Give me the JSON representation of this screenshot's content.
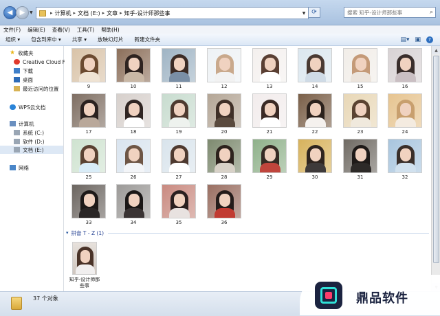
{
  "address_bar": {
    "crumbs": [
      "计算机",
      "文档 (E:)",
      "文章",
      "知乎-设计师那些事"
    ],
    "search_placeholder": "搜索 知乎-设计师那些事"
  },
  "menu": [
    "文件(F)",
    "编辑(E)",
    "查看(V)",
    "工具(T)",
    "帮助(H)"
  ],
  "toolbar": {
    "organize": "组织 ▾",
    "include_library": "包含到库中 ▾",
    "share": "共享 ▾",
    "slideshow": "放映幻灯片",
    "new_folder": "新建文件夹"
  },
  "sidebar": {
    "favorites": "收藏夹",
    "creative_cloud": "Creative Cloud Files",
    "downloads": "下载",
    "desktop": "桌面",
    "recent": "最近访问的位置",
    "wps_cloud": "WPS云文档",
    "computer": "计算机",
    "drive_c": "系统 (C:)",
    "drive_d": "软件 (D:)",
    "drive_e": "文档 (E:)",
    "network": "网络"
  },
  "thumbnails": [
    "9",
    "10",
    "11",
    "12",
    "13",
    "14",
    "15",
    "16",
    "17",
    "18",
    "19",
    "20",
    "21",
    "22",
    "23",
    "24",
    "25",
    "26",
    "27",
    "28",
    "29",
    "30",
    "31",
    "32",
    "33",
    "34",
    "35",
    "36"
  ],
  "group_header": "拼音 T - Z (1)",
  "folder_item": "知乎-设计师那些事",
  "status": {
    "count": "37 个对象"
  },
  "watermark": "鼎品软件",
  "colors": {
    "selection": "#dde8f5",
    "group_header_text": "#1e3b8f",
    "titlebar": "#c5d8ee"
  }
}
